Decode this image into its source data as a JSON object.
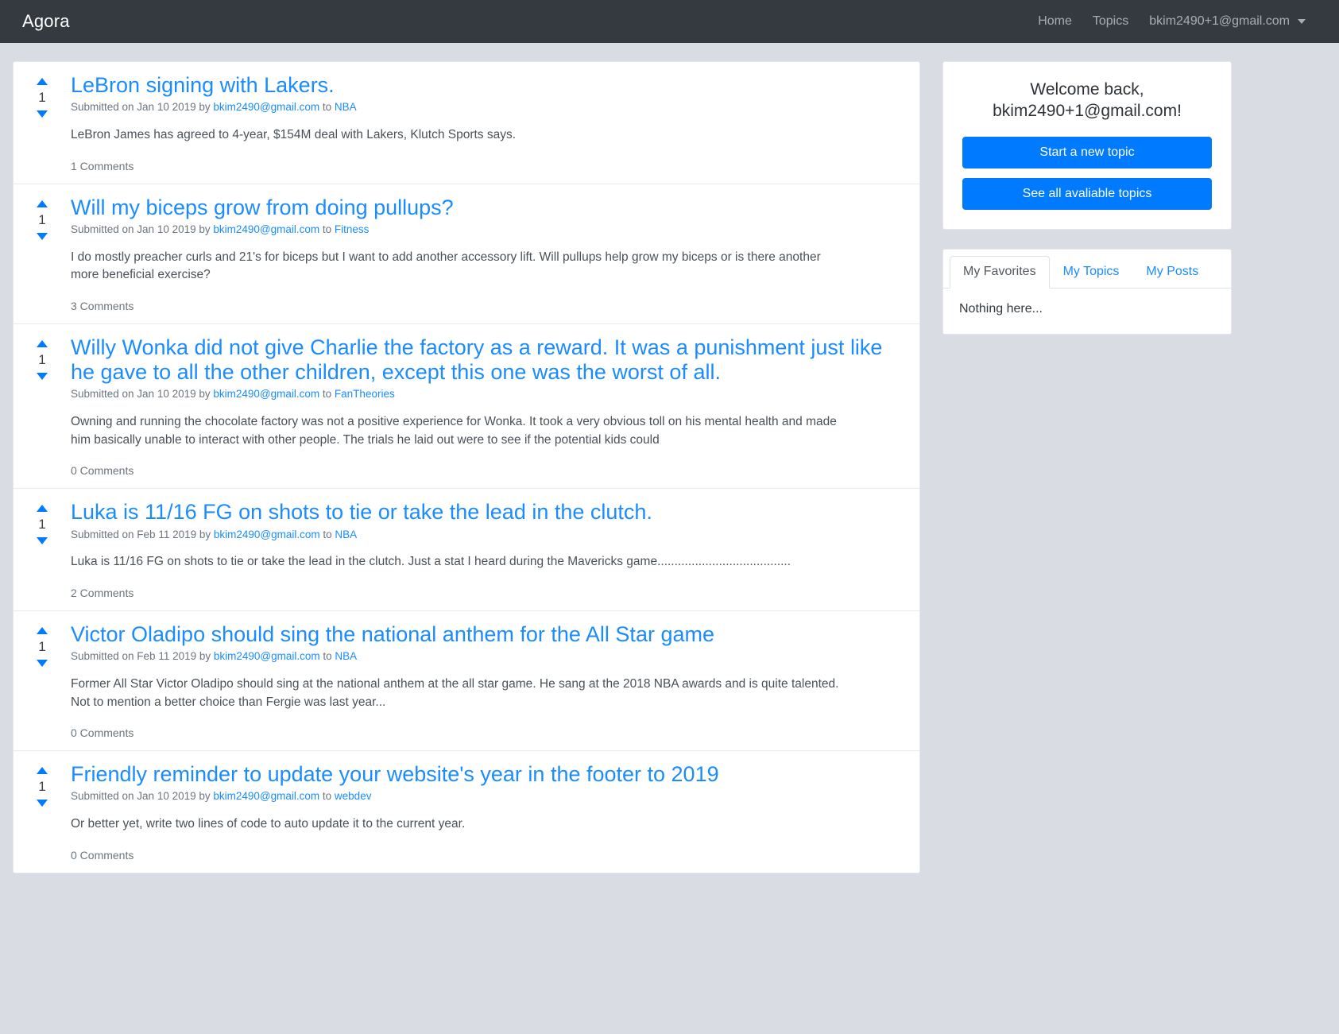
{
  "navbar": {
    "brand": "Agora",
    "links": [
      {
        "label": "Home",
        "name": "nav-link-home"
      },
      {
        "label": "Topics",
        "name": "nav-link-topics"
      }
    ],
    "user": "bkim2490+1@gmail.com",
    "caret_icon": "chevron-down-icon"
  },
  "colors": {
    "accent": "#007bff",
    "link": "#1a8cff",
    "navbar_bg": "#343a40",
    "page_bg": "#d9dde3"
  },
  "posts": [
    {
      "score": "1",
      "title": "LeBron signing with Lakers.",
      "meta_prefix": "Submitted on Jan 10 2019 by ",
      "author": "bkim2490@gmail.com",
      "meta_to": " to ",
      "topic": "NBA",
      "text": "LeBron James has agreed to 4-year, $154M deal with Lakers, Klutch Sports says.",
      "comments": "1 Comments"
    },
    {
      "score": "1",
      "title": "Will my biceps grow from doing pullups?",
      "meta_prefix": "Submitted on Jan 10 2019 by ",
      "author": "bkim2490@gmail.com",
      "meta_to": " to ",
      "topic": "Fitness",
      "text": "I do mostly preacher curls and 21's for biceps but I want to add another accessory lift. Will pullups help grow my biceps or is there another more beneficial exercise?",
      "comments": "3 Comments"
    },
    {
      "score": "1",
      "title": "Willy Wonka did not give Charlie the factory as a reward. It was a punishment just like he gave to all the other children, except this one was the worst of all.",
      "meta_prefix": "Submitted on Jan 10 2019 by ",
      "author": "bkim2490@gmail.com",
      "meta_to": " to ",
      "topic": "FanTheories",
      "text": "Owning and running the chocolate factory was not a positive experience for Wonka. It took a very obvious toll on his mental health and made him basically unable to interact with other people. The trials he laid out were to see if the potential kids could",
      "comments": "0 Comments"
    },
    {
      "score": "1",
      "title": "Luka is 11/16 FG on shots to tie or take the lead in the clutch.",
      "meta_prefix": "Submitted on Feb 11 2019 by ",
      "author": "bkim2490@gmail.com",
      "meta_to": " to ",
      "topic": "NBA",
      "text": "Luka is 11/16 FG on shots to tie or take the lead in the clutch. Just a stat I heard during the Mavericks game.......................................",
      "comments": "2 Comments"
    },
    {
      "score": "1",
      "title": "Victor Oladipo should sing the national anthem for the All Star game",
      "meta_prefix": "Submitted on Feb 11 2019 by ",
      "author": "bkim2490@gmail.com",
      "meta_to": " to ",
      "topic": "NBA",
      "text": "Former All Star Victor Oladipo should sing at the national anthem at the all star game. He sang at the 2018 NBA awards and is quite talented. Not to mention a better choice than Fergie was last year...",
      "comments": "0 Comments"
    },
    {
      "score": "1",
      "title": "Friendly reminder to update your website's year in the footer to 2019",
      "meta_prefix": "Submitted on Jan 10 2019 by ",
      "author": "bkim2490@gmail.com",
      "meta_to": " to ",
      "topic": "webdev",
      "text": "Or better yet, write two lines of code to auto update it to the current year.",
      "comments": "0 Comments"
    }
  ],
  "sidebar": {
    "welcome_line1": "Welcome back,",
    "welcome_line2": "bkim2490+1@gmail.com!",
    "new_topic_button": "Start a new topic",
    "all_topics_button": "See all avaliable topics",
    "tabs": [
      {
        "label": "My Favorites",
        "active": true
      },
      {
        "label": "My Topics",
        "active": false
      },
      {
        "label": "My Posts",
        "active": false
      }
    ],
    "tab_body": "Nothing here..."
  }
}
